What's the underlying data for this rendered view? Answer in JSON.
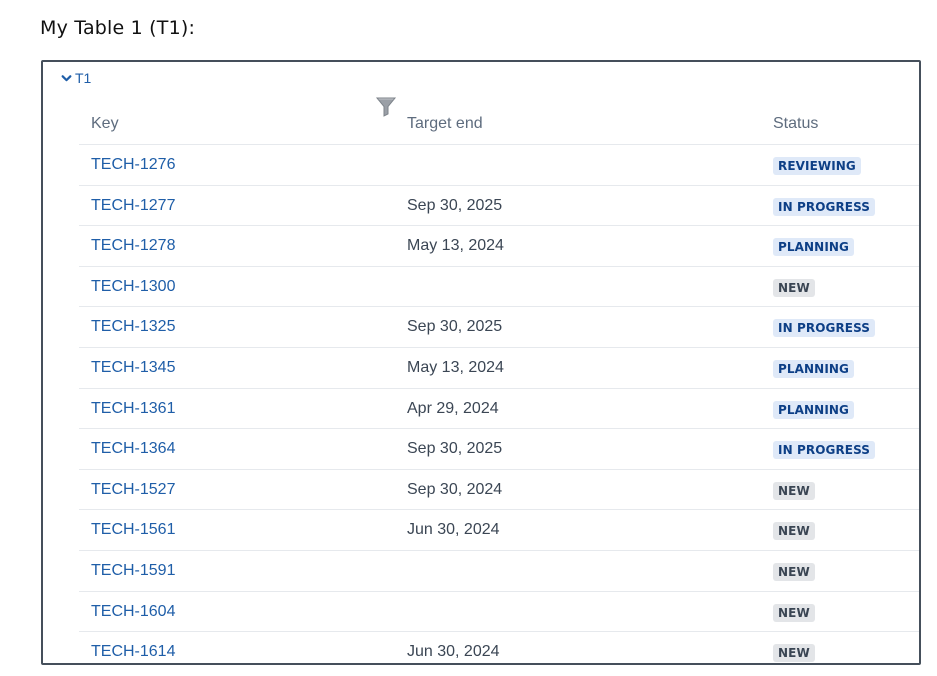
{
  "heading": "My Table 1 (T1):",
  "panel": {
    "group_label": "T1"
  },
  "table": {
    "columns": {
      "key": "Key",
      "target_end": "Target end",
      "status": "Status"
    },
    "rows": [
      {
        "key": "TECH-1276",
        "target_end": "",
        "status": "REVIEWING",
        "status_color": "blue"
      },
      {
        "key": "TECH-1277",
        "target_end": "Sep 30, 2025",
        "status": "IN PROGRESS",
        "status_color": "blue"
      },
      {
        "key": "TECH-1278",
        "target_end": "May 13, 2024",
        "status": "PLANNING",
        "status_color": "blue"
      },
      {
        "key": "TECH-1300",
        "target_end": "",
        "status": "NEW",
        "status_color": "gray"
      },
      {
        "key": "TECH-1325",
        "target_end": "Sep 30, 2025",
        "status": "IN PROGRESS",
        "status_color": "blue"
      },
      {
        "key": "TECH-1345",
        "target_end": "May 13, 2024",
        "status": "PLANNING",
        "status_color": "blue"
      },
      {
        "key": "TECH-1361",
        "target_end": "Apr 29, 2024",
        "status": "PLANNING",
        "status_color": "blue"
      },
      {
        "key": "TECH-1364",
        "target_end": "Sep 30, 2025",
        "status": "IN PROGRESS",
        "status_color": "blue"
      },
      {
        "key": "TECH-1527",
        "target_end": "Sep 30, 2024",
        "status": "NEW",
        "status_color": "gray"
      },
      {
        "key": "TECH-1561",
        "target_end": "Jun 30, 2024",
        "status": "NEW",
        "status_color": "gray"
      },
      {
        "key": "TECH-1591",
        "target_end": "",
        "status": "NEW",
        "status_color": "gray"
      },
      {
        "key": "TECH-1604",
        "target_end": "",
        "status": "NEW",
        "status_color": "gray"
      },
      {
        "key": "TECH-1614",
        "target_end": "Jun 30, 2024",
        "status": "NEW",
        "status_color": "gray"
      }
    ]
  },
  "icons": {
    "expander": "chevron-down-icon",
    "filter": "filter-icon"
  },
  "colors": {
    "link": "#1f5ea8",
    "border": "#454f5b",
    "lozenge_blue_bg": "#dfe9f8",
    "lozenge_blue_text": "#0d3f86",
    "lozenge_gray_bg": "#e3e5e8",
    "lozenge_gray_text": "#3a4553"
  }
}
